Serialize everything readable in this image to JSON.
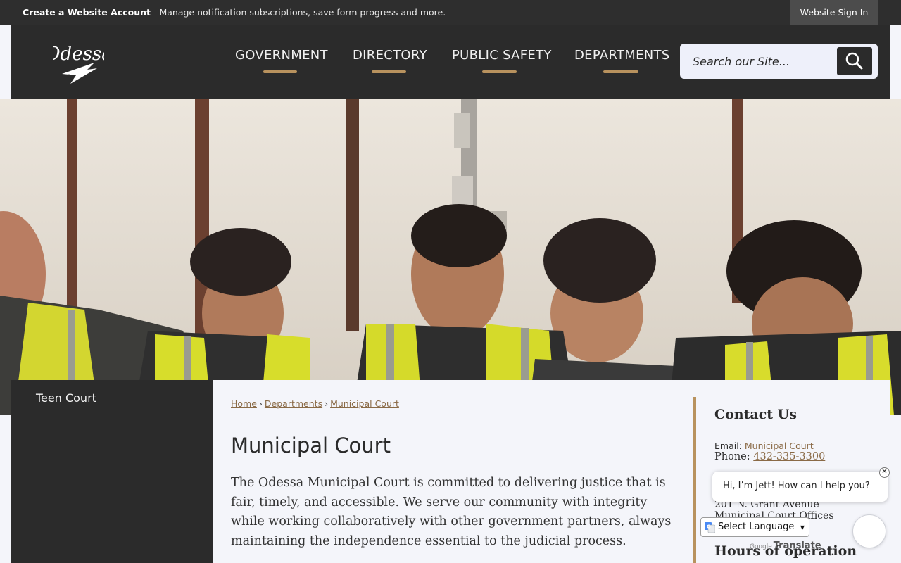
{
  "utility_bar": {
    "create_account_label": "Create a Website Account",
    "create_account_desc": " - Manage notification subscriptions, save form progress and more.",
    "sign_in_label": "Website Sign In"
  },
  "header": {
    "logo_text": "Odessa",
    "nav": [
      {
        "label": "GOVERNMENT"
      },
      {
        "label": "DIRECTORY"
      },
      {
        "label": "PUBLIC SAFETY"
      },
      {
        "label": "DEPARTMENTS"
      }
    ],
    "search": {
      "placeholder": "Search our Site..."
    }
  },
  "sidebar": {
    "items": [
      {
        "label": "Teen Court"
      }
    ]
  },
  "breadcrumb": {
    "items": [
      {
        "label": "Home"
      },
      {
        "label": "Departments"
      },
      {
        "label": "Municipal Court"
      }
    ],
    "separator": "›"
  },
  "page": {
    "title": "Municipal Court",
    "intro": "The Odessa Municipal Court is committed to delivering justice that is fair, timely, and accessible. We serve our community with integrity while working collaboratively with other government partners, always maintaining the independence essential to the judicial process."
  },
  "contact": {
    "heading": "Contact Us",
    "email_label": "Email:",
    "email_link": "Municipal Court",
    "phone_label": "Phone:",
    "phone_link": "432-335-3300",
    "address_line1": "201 N. Grant Avenue",
    "address_line2": "Municipal Court Offices",
    "hours_heading": "Hours of operation"
  },
  "chat": {
    "message": "Hi, I’m Jett! How can I help you?",
    "close_glyph": "✕"
  },
  "translate": {
    "select_label": "Select Language",
    "caret": "▼",
    "powered_by": "Google",
    "powered_word": "Translate"
  },
  "colors": {
    "accent": "#b8925e",
    "header_bg": "#2b2b2b",
    "link": "#8a6a46"
  }
}
